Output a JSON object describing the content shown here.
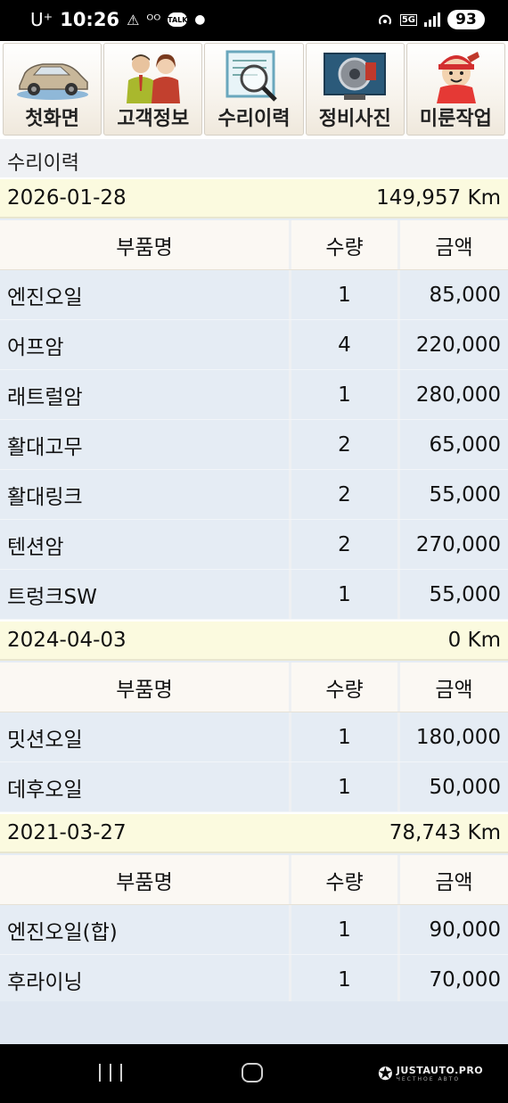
{
  "status_bar": {
    "carrier": "U⁺",
    "time": "10:26",
    "battery": "93",
    "network": "5G"
  },
  "nav": [
    {
      "label": "첫화면",
      "icon": "car-icon"
    },
    {
      "label": "고객정보",
      "icon": "customers-icon"
    },
    {
      "label": "수리이력",
      "icon": "document-magnifier-icon"
    },
    {
      "label": "정비사진",
      "icon": "brake-photo-icon"
    },
    {
      "label": "미룬작업",
      "icon": "mechanic-icon"
    }
  ],
  "page_title": "수리이력",
  "columns": {
    "part": "부품명",
    "qty": "수량",
    "amount": "금액"
  },
  "records": [
    {
      "date": "2026-01-28",
      "mileage": "149,957 Km",
      "items": [
        {
          "part": "엔진오일",
          "qty": "1",
          "amount": "85,000"
        },
        {
          "part": "어프암",
          "qty": "4",
          "amount": "220,000"
        },
        {
          "part": "래트럴암",
          "qty": "1",
          "amount": "280,000"
        },
        {
          "part": "활대고무",
          "qty": "2",
          "amount": "65,000"
        },
        {
          "part": "활대링크",
          "qty": "2",
          "amount": "55,000"
        },
        {
          "part": "텐션암",
          "qty": "2",
          "amount": "270,000"
        },
        {
          "part": "트렁크SW",
          "qty": "1",
          "amount": "55,000"
        }
      ]
    },
    {
      "date": "2024-04-03",
      "mileage": "0 Km",
      "items": [
        {
          "part": "밋션오일",
          "qty": "1",
          "amount": "180,000"
        },
        {
          "part": "데후오일",
          "qty": "1",
          "amount": "50,000"
        }
      ]
    },
    {
      "date": "2021-03-27",
      "mileage": "78,743 Km",
      "items": [
        {
          "part": "엔진오일(합)",
          "qty": "1",
          "amount": "90,000"
        },
        {
          "part": "후라이닝",
          "qty": "1",
          "amount": "70,000"
        }
      ]
    }
  ],
  "watermark": {
    "line1": "JUSTAUTO.PRO",
    "line2": "ЧЕСТНОЕ АВТО"
  }
}
